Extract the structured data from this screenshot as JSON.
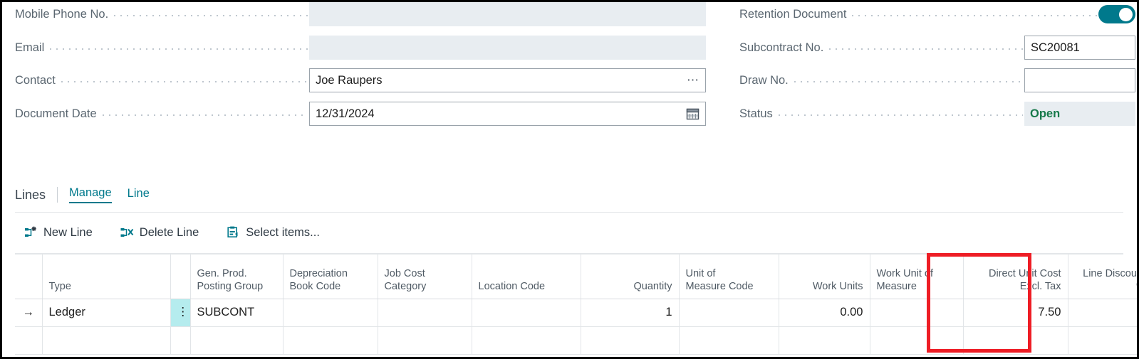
{
  "theme": {
    "accent": "#00798c",
    "status_open_color": "#16794a",
    "highlight_color": "#ee1d25",
    "selected_cell_color": "#b5ecee"
  },
  "general_fields": {
    "left": [
      {
        "label": "Mobile Phone No.",
        "value": "",
        "state": "disabled",
        "adornment": "none"
      },
      {
        "label": "Email",
        "value": "",
        "state": "disabled",
        "adornment": "none"
      },
      {
        "label": "Contact",
        "value": "Joe Raupers",
        "state": "editable",
        "adornment": "ellipsis"
      },
      {
        "label": "Document Date",
        "value": "12/31/2024",
        "state": "editable",
        "adornment": "calendar"
      }
    ],
    "right": [
      {
        "label": "Retention Document",
        "value": "on",
        "state": "toggle",
        "adornment": "none"
      },
      {
        "label": "Subcontract No.",
        "value": "SC20081",
        "state": "editable",
        "adornment": "none"
      },
      {
        "label": "Draw No.",
        "value": "",
        "state": "editable",
        "adornment": "none"
      },
      {
        "label": "Status",
        "value": "Open",
        "state": "readonly",
        "adornment": "none"
      }
    ]
  },
  "lines_section": {
    "title": "Lines",
    "actions": [
      {
        "label": "Manage",
        "active": true
      },
      {
        "label": "Line",
        "active": false
      }
    ],
    "toolbar": [
      {
        "label": "New Line",
        "icon": "new-line-icon"
      },
      {
        "label": "Delete Line",
        "icon": "delete-line-icon"
      },
      {
        "label": "Select items...",
        "icon": "select-items-icon"
      }
    ]
  },
  "grid": {
    "columns": [
      {
        "key": "arrow",
        "header": "",
        "align": "left"
      },
      {
        "key": "type",
        "header": "Type",
        "align": "left"
      },
      {
        "key": "dots",
        "header": "",
        "align": "left"
      },
      {
        "key": "gen_prod",
        "header": "Gen. Prod.\nPosting Group",
        "align": "left"
      },
      {
        "key": "depr_book",
        "header": "Depreciation\nBook Code",
        "align": "left"
      },
      {
        "key": "job_cost",
        "header": "Job Cost\nCategory",
        "align": "left"
      },
      {
        "key": "location",
        "header": "Location Code",
        "align": "left"
      },
      {
        "key": "quantity",
        "header": "Quantity",
        "align": "right"
      },
      {
        "key": "uom_code",
        "header": "Unit of\nMeasure Code",
        "align": "left"
      },
      {
        "key": "work_units",
        "header": "Work Units",
        "align": "right"
      },
      {
        "key": "work_uom",
        "header": "Work Unit of\nMeasure",
        "align": "left"
      },
      {
        "key": "direct_cost",
        "header": "Direct Unit Cost\nExcl. Tax",
        "align": "right"
      },
      {
        "key": "line_disc",
        "header": "Line Discount %",
        "align": "right"
      }
    ],
    "rows": [
      {
        "selected": true,
        "arrow": "→",
        "type": "Ledger",
        "dots": "⋮",
        "gen_prod": "SUBCONT",
        "depr_book": "",
        "job_cost": "",
        "location": "",
        "quantity": "1",
        "uom_code": "",
        "work_units": "0.00",
        "work_uom": "",
        "direct_cost": "7.50",
        "line_disc": ""
      },
      {
        "selected": false,
        "arrow": "",
        "type": "",
        "dots": "",
        "gen_prod": "",
        "depr_book": "",
        "job_cost": "",
        "location": "",
        "quantity": "",
        "uom_code": "",
        "work_units": "",
        "work_uom": "",
        "direct_cost": "",
        "line_disc": ""
      }
    ],
    "highlight": {
      "column": "direct_cost",
      "label": "Direct Unit Cost Excl. Tax"
    }
  }
}
